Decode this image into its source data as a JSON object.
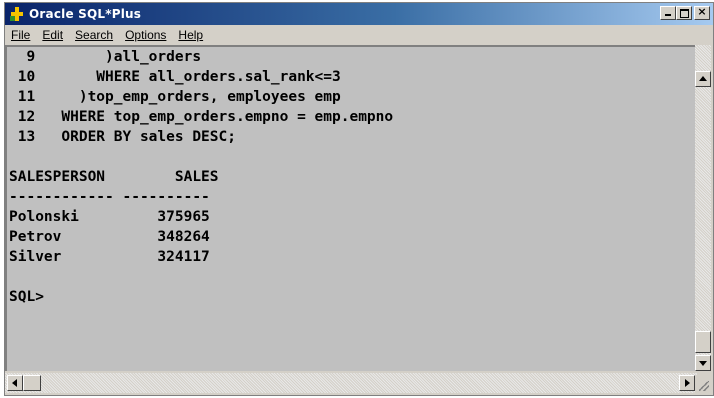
{
  "window": {
    "title": "Oracle SQL*Plus",
    "controls": {
      "minimize": "minimize",
      "maximize": "maximize",
      "close": "×"
    }
  },
  "menu": [
    {
      "label": "File"
    },
    {
      "label": "Edit"
    },
    {
      "label": "Search"
    },
    {
      "label": "Options"
    },
    {
      "label": "Help"
    }
  ],
  "console": {
    "lines": [
      "  9        )all_orders",
      " 10       WHERE all_orders.sal_rank<=3",
      " 11     )top_emp_orders, employees emp",
      " 12   WHERE top_emp_orders.empno = emp.empno",
      " 13   ORDER BY sales DESC;",
      "",
      "SALESPERSON        SALES",
      "------------ ----------",
      "Polonski         375965",
      "Petrov           348264",
      "Silver           324117",
      "",
      "SQL>"
    ]
  }
}
